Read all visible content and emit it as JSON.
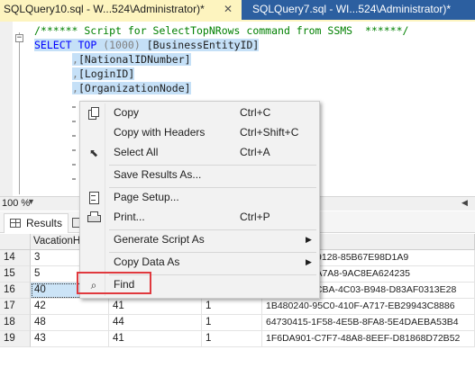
{
  "tabs": [
    {
      "label": "SQLQuery10.sql - W...524\\Administrator)*",
      "close": "✕"
    },
    {
      "label": "SQLQuery7.sql - WI...524\\Administrator)*"
    }
  ],
  "editor": {
    "fold_symbol": "−",
    "comment": "/****** Script for SelectTopNRows command from SSMS  ******/",
    "select_kw": "SELECT",
    "top_kw": "TOP",
    "top_value": "(1000)",
    "first_col": "[BusinessEntityID]",
    "lines": [
      {
        "comma": ",",
        "col": "[NationalIDNumber]"
      },
      {
        "comma": ",",
        "col": "[LoginID]"
      },
      {
        "comma": ",",
        "col": "[OrganizationNode]"
      }
    ]
  },
  "zoom": {
    "value": "100 %",
    "caret": "▼"
  },
  "results": {
    "tab_results": "Results",
    "header_visible": "VacationH",
    "rows": [
      {
        "num": "14",
        "c1": "3",
        "c2": "",
        "c3": "",
        "c4": "6DD-4DDB-9128-85B67E98D1A9"
      },
      {
        "num": "15",
        "c1": "5",
        "c2": "",
        "c3": "",
        "c4": "37C4-4065-A7A8-9AC8EA624235"
      },
      {
        "num": "16",
        "c1": "40",
        "c2": "",
        "c3": "",
        "c4": "E67825A72CBA-4C03-B948-D83AF0313E28"
      },
      {
        "num": "17",
        "c1": "42",
        "c2": "41",
        "c3": "1",
        "c4": "1B480240-95C0-410F-A717-EB29943C8886"
      },
      {
        "num": "18",
        "c1": "48",
        "c2": "44",
        "c3": "1",
        "c4": "64730415-1F58-4E5B-8FA8-5E4DAEBA53B4"
      },
      {
        "num": "19",
        "c1": "43",
        "c2": "41",
        "c3": "1",
        "c4": "1F6DA901-C7F7-48A8-8EEF-D81868D72B52"
      }
    ]
  },
  "context_menu": {
    "items": [
      {
        "label": "Copy",
        "shortcut": "Ctrl+C",
        "icon": "copy-icon"
      },
      {
        "label": "Copy with Headers",
        "shortcut": "Ctrl+Shift+C"
      },
      {
        "label": "Select All",
        "shortcut": "Ctrl+A",
        "icon": "select-all-icon"
      },
      {
        "label": "Save Results As..."
      },
      {
        "label": "Page Setup...",
        "icon": "page-setup-icon"
      },
      {
        "label": "Print...",
        "shortcut": "Ctrl+P",
        "icon": "print-icon"
      },
      {
        "label": "Generate Script As",
        "submenu": "▶"
      },
      {
        "label": "Copy Data As",
        "submenu": "▶"
      },
      {
        "label": "Find",
        "icon": "find-icon"
      }
    ],
    "icon_glyphs": {
      "select_all": "⬉",
      "find": "⌕"
    }
  },
  "colors": {
    "active_tab": "#fdf4bf",
    "inactive_tab": "#2c5fa0",
    "comment": "#008000",
    "keyword": "#0000ff",
    "selection": "#c5e0f7",
    "find_highlight": "#e0393e"
  }
}
